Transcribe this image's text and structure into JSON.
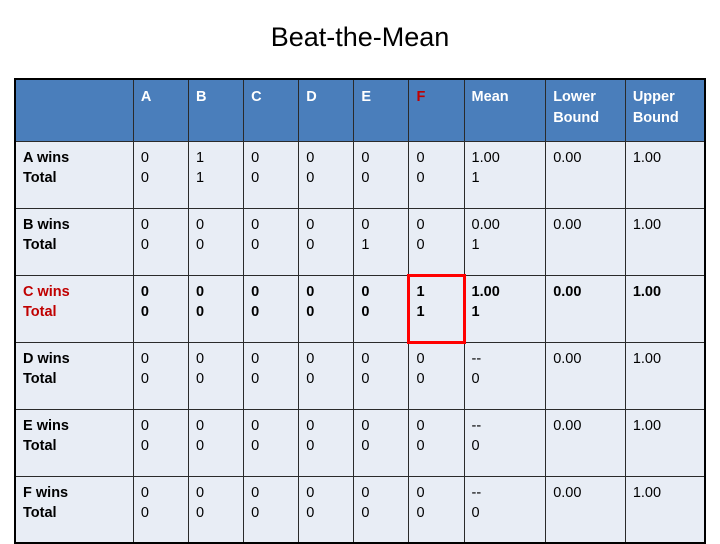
{
  "title": "Beat-the-Mean",
  "colors": {
    "header_blue": "#4A7EBB",
    "cell_bg": "#E8EDF5",
    "highlight_red": "#C00000",
    "box_red": "#FF0000",
    "text": "#000000"
  },
  "table": {
    "corner_label": "",
    "columns": [
      {
        "key": "A",
        "label": "A",
        "highlight": false
      },
      {
        "key": "B",
        "label": "B",
        "highlight": false
      },
      {
        "key": "C",
        "label": "C",
        "highlight": false
      },
      {
        "key": "D",
        "label": "D",
        "highlight": false
      },
      {
        "key": "E",
        "label": "E",
        "highlight": false
      },
      {
        "key": "F",
        "label": "F",
        "highlight": true
      }
    ],
    "summary_columns": [
      {
        "key": "mean",
        "label": "Mean"
      },
      {
        "key": "lower",
        "label_line1": "Lower",
        "label_line2": "Bound"
      },
      {
        "key": "upper",
        "label_line1": "Upper",
        "label_line2": "Bound"
      }
    ],
    "rows": [
      {
        "label_line1": "A wins",
        "label_line2": "Total",
        "highlight": false,
        "cells": [
          {
            "wins": "0",
            "total": "0"
          },
          {
            "wins": "1",
            "total": "1"
          },
          {
            "wins": "0",
            "total": "0"
          },
          {
            "wins": "0",
            "total": "0"
          },
          {
            "wins": "0",
            "total": "0"
          },
          {
            "wins": "0",
            "total": "0"
          }
        ],
        "mean": {
          "value": "1.00",
          "count": "1"
        },
        "lower": "0.00",
        "upper": "1.00"
      },
      {
        "label_line1": "B wins",
        "label_line2": "Total",
        "highlight": false,
        "cells": [
          {
            "wins": "0",
            "total": "0"
          },
          {
            "wins": "0",
            "total": "0"
          },
          {
            "wins": "0",
            "total": "0"
          },
          {
            "wins": "0",
            "total": "0"
          },
          {
            "wins": "0",
            "total": "1"
          },
          {
            "wins": "0",
            "total": "0"
          }
        ],
        "mean": {
          "value": "0.00",
          "count": "1"
        },
        "lower": "0.00",
        "upper": "1.00"
      },
      {
        "label_line1": "C wins",
        "label_line2": "Total",
        "highlight": true,
        "cells": [
          {
            "wins": "0",
            "total": "0"
          },
          {
            "wins": "0",
            "total": "0"
          },
          {
            "wins": "0",
            "total": "0"
          },
          {
            "wins": "0",
            "total": "0"
          },
          {
            "wins": "0",
            "total": "0"
          },
          {
            "wins": "1",
            "total": "1",
            "boxed": true
          }
        ],
        "mean": {
          "value": "1.00",
          "count": "1"
        },
        "lower": "0.00",
        "upper": "1.00"
      },
      {
        "label_line1": "D wins",
        "label_line2": "Total",
        "highlight": false,
        "cells": [
          {
            "wins": "0",
            "total": "0"
          },
          {
            "wins": "0",
            "total": "0"
          },
          {
            "wins": "0",
            "total": "0"
          },
          {
            "wins": "0",
            "total": "0"
          },
          {
            "wins": "0",
            "total": "0"
          },
          {
            "wins": "0",
            "total": "0"
          }
        ],
        "mean": {
          "value": "--",
          "count": "0"
        },
        "lower": "0.00",
        "upper": "1.00"
      },
      {
        "label_line1": "E wins",
        "label_line2": "Total",
        "highlight": false,
        "cells": [
          {
            "wins": "0",
            "total": "0"
          },
          {
            "wins": "0",
            "total": "0"
          },
          {
            "wins": "0",
            "total": "0"
          },
          {
            "wins": "0",
            "total": "0"
          },
          {
            "wins": "0",
            "total": "0"
          },
          {
            "wins": "0",
            "total": "0"
          }
        ],
        "mean": {
          "value": "--",
          "count": "0"
        },
        "lower": "0.00",
        "upper": "1.00"
      },
      {
        "label_line1": "F wins",
        "label_line2": "Total",
        "highlight": false,
        "cells": [
          {
            "wins": "0",
            "total": "0"
          },
          {
            "wins": "0",
            "total": "0"
          },
          {
            "wins": "0",
            "total": "0"
          },
          {
            "wins": "0",
            "total": "0"
          },
          {
            "wins": "0",
            "total": "0"
          },
          {
            "wins": "0",
            "total": "0"
          }
        ],
        "mean": {
          "value": "--",
          "count": "0"
        },
        "lower": "0.00",
        "upper": "1.00"
      }
    ]
  }
}
